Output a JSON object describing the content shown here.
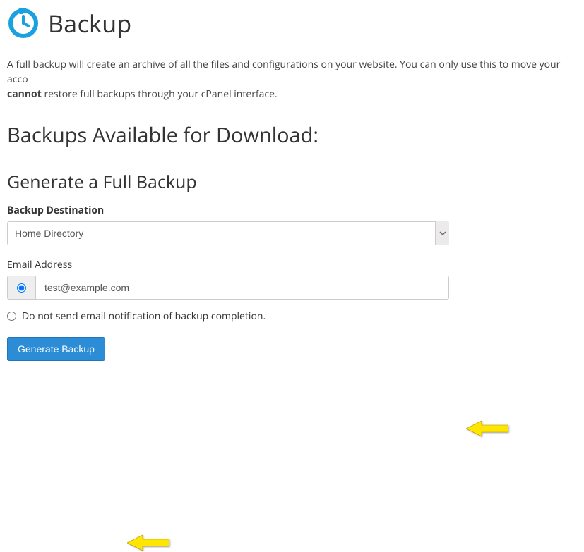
{
  "header": {
    "title": "Backup"
  },
  "intro": {
    "text_before": "A full backup will create an archive of all the files and configurations on your website. You can only use this to move your acco",
    "cannot": "cannot",
    "text_after": " restore full backups through your cPanel interface."
  },
  "sections": {
    "available_title": "Backups Available for Download:",
    "generate_title": "Generate a Full Backup"
  },
  "form": {
    "destination_label": "Backup Destination",
    "destination_value": "Home Directory",
    "email_label": "Email Address",
    "email_value": "test@example.com",
    "no_email_label": "Do not send email notification of backup completion.",
    "submit_label": "Generate Backup"
  }
}
